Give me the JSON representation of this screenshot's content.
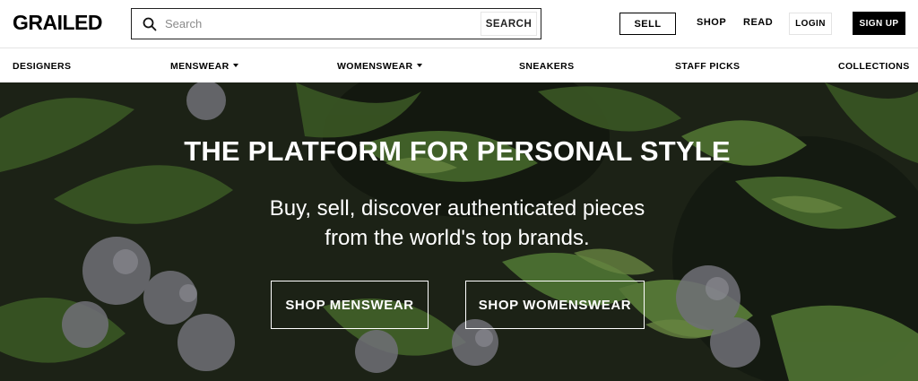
{
  "header": {
    "logo": "GRAILED",
    "search": {
      "placeholder": "Search",
      "button_label": "SEARCH"
    },
    "sell_label": "SELL",
    "shop_label": "SHOP",
    "read_label": "READ",
    "login_label": "LOGIN",
    "signup_label": "SIGN UP"
  },
  "categories": {
    "designers": "DESIGNERS",
    "menswear": "MENSWEAR",
    "womenswear": "WOMENSWEAR",
    "sneakers": "SNEAKERS",
    "staff_picks": "STAFF PICKS",
    "collections": "COLLECTIONS"
  },
  "hero": {
    "title": "THE PLATFORM FOR PERSONAL STYLE",
    "subtitle_line1": "Buy, sell, discover authenticated pieces",
    "subtitle_line2": "from the world's top brands.",
    "shop_menswear_label": "SHOP MENSWEAR",
    "shop_womenswear_label": "SHOP WOMENSWEAR"
  },
  "colors": {
    "accent": "#000000",
    "hero_text": "#ffffff",
    "foliage_dark": "#1f2a1a",
    "foliage_green": "#4f7a32",
    "foliage_light": "#8fb85a",
    "bud_gray": "#9a9aa4"
  },
  "icons": {
    "search": "search-icon",
    "dropdown": "chevron-down-icon"
  }
}
